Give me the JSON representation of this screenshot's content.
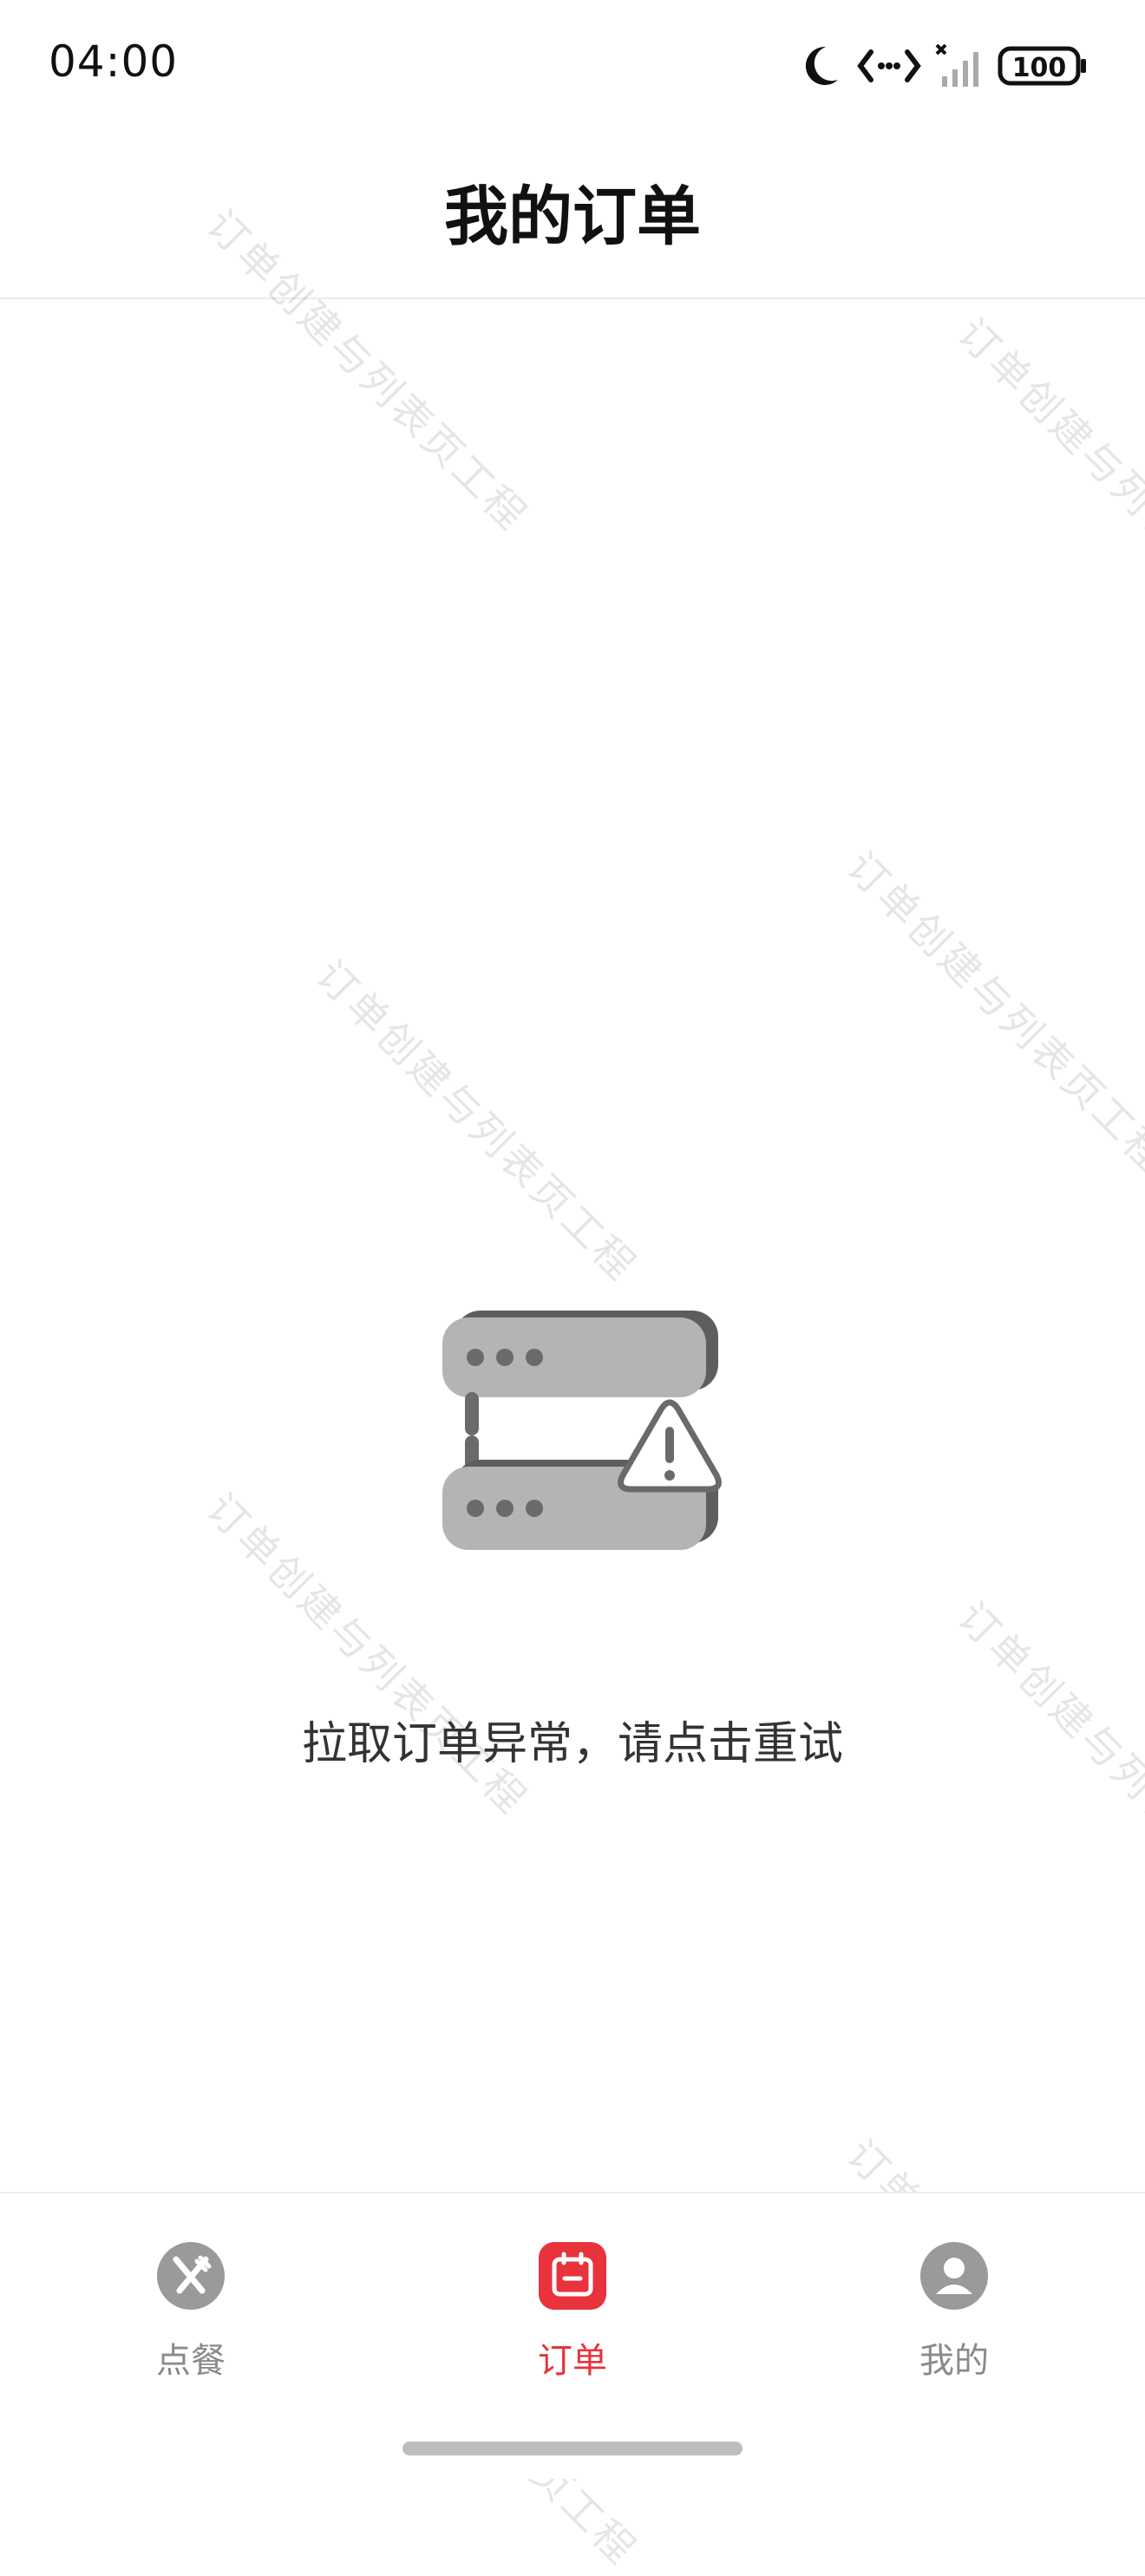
{
  "status_bar": {
    "time": "04:00",
    "battery": "100",
    "icons": [
      "moon-icon",
      "data-transfer-icon",
      "signal-icon",
      "battery-icon"
    ]
  },
  "header": {
    "title": "我的订单"
  },
  "watermark": {
    "text": "订单创建与列表页工程"
  },
  "error_state": {
    "message": "拉取订单异常，请点击重试",
    "icon": "server-warning-icon"
  },
  "tab_bar": {
    "active_color": "#e8323c",
    "inactive_color": "#8a8a8a",
    "tabs": [
      {
        "label": "点餐",
        "icon": "fork-knife-icon",
        "active": false
      },
      {
        "label": "订单",
        "icon": "order-calendar-icon",
        "active": true
      },
      {
        "label": "我的",
        "icon": "user-icon",
        "active": false
      }
    ]
  }
}
